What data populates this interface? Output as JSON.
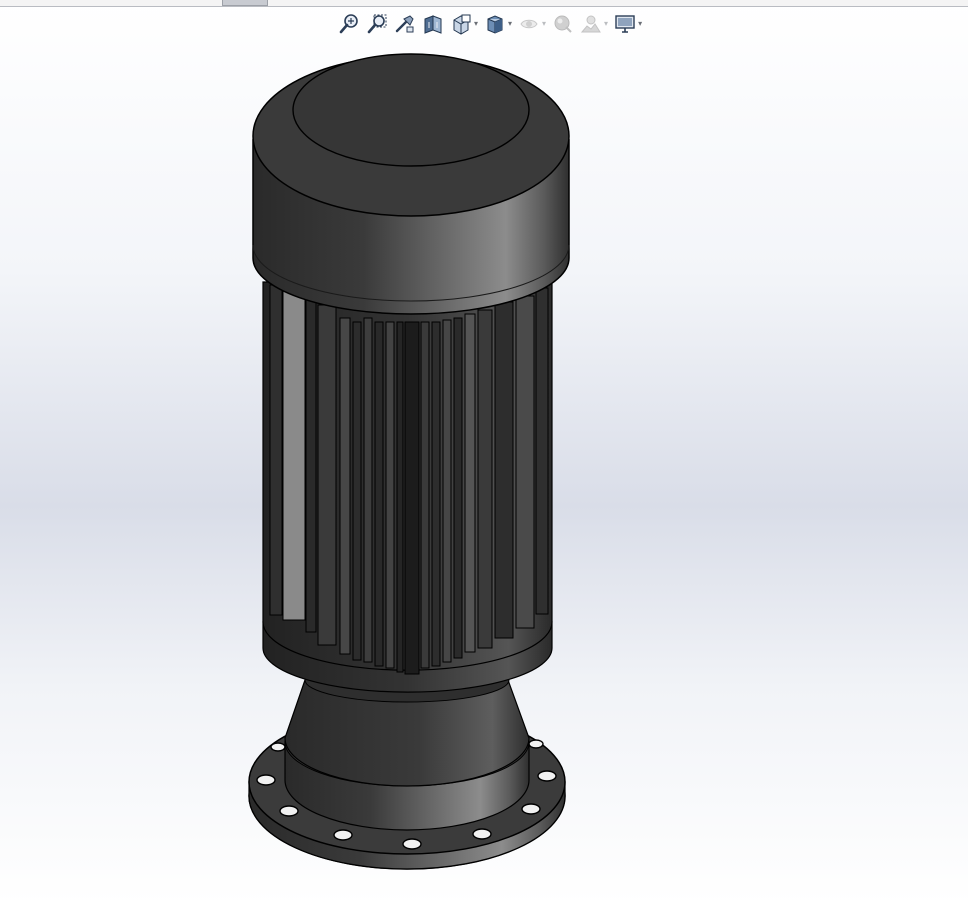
{
  "viewport": {
    "background_top": "#ffffff",
    "background_mid": "#d9dde8",
    "model_color": "#3a3a3a"
  },
  "heads_up_toolbar": {
    "tools": [
      {
        "name": "zoom-to-fit-icon",
        "dropdown": false,
        "enabled": true
      },
      {
        "name": "zoom-to-area-icon",
        "dropdown": false,
        "enabled": true
      },
      {
        "name": "previous-view-icon",
        "dropdown": false,
        "enabled": true
      },
      {
        "name": "section-view-icon",
        "dropdown": false,
        "enabled": true
      },
      {
        "name": "view-orientation-icon",
        "dropdown": true,
        "enabled": true
      },
      {
        "name": "display-style-icon",
        "dropdown": true,
        "enabled": true
      },
      {
        "name": "hide-show-items-icon",
        "dropdown": true,
        "enabled": false
      },
      {
        "name": "edit-appearance-icon",
        "dropdown": false,
        "enabled": false
      },
      {
        "name": "apply-scene-icon",
        "dropdown": true,
        "enabled": false
      },
      {
        "name": "view-settings-icon",
        "dropdown": true,
        "enabled": true
      }
    ]
  }
}
